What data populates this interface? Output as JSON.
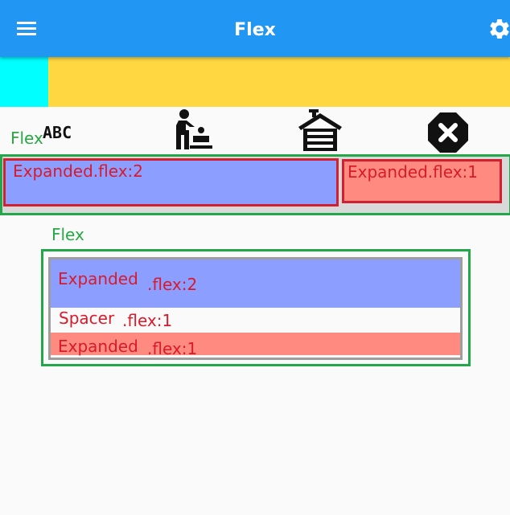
{
  "appbar": {
    "title": "Flex",
    "menu_icon": "menu-icon",
    "settings_icon": "gear-icon",
    "color": "#2196f3"
  },
  "top_blocks": {
    "left_color": "#00ffff",
    "right_color": "#ffd740"
  },
  "row_section": {
    "label": "Flex",
    "icons": [
      "abc-icon",
      "baby-changing-station-icon",
      "garage-icon",
      "cancel-icon"
    ],
    "expanded_2_label": "Expanded.flex:2",
    "expanded_1_label": "Expanded.flex:1"
  },
  "column_section": {
    "label": "Flex",
    "expanded_2": {
      "name": "Expanded",
      "flex": ".flex:2"
    },
    "spacer": {
      "name": "Spacer",
      "flex": ".flex:1"
    },
    "expanded_1": {
      "name": "Expanded",
      "flex": ".flex:1"
    }
  },
  "colors": {
    "outline_green": "#22a84a",
    "outline_red": "#d32030",
    "text_red": "#d81b2b",
    "expanded_blue": "#8c9eff",
    "expanded_red": "#ff8a80"
  }
}
